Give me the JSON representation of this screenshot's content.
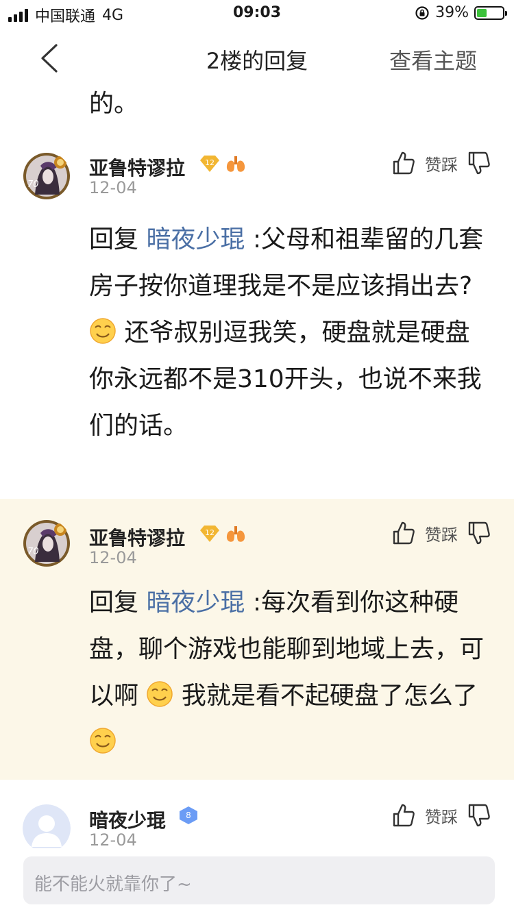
{
  "status_bar": {
    "carrier": "中国联通",
    "network": "4G",
    "time": "09:03",
    "battery": "39%",
    "battery_level": 0.39
  },
  "nav": {
    "title": "2楼的回复",
    "view_topic": "查看主题"
  },
  "partial_text": "的。",
  "replies": [
    {
      "username": "亚鲁特谬拉",
      "level_badge": "12",
      "avatar_level": "70",
      "date": "12-04",
      "vote_label": "赞踩",
      "reply_prefix": "回复",
      "mention": "暗夜少琨",
      "text_part1": ":父母和祖辈留的几套房子按你道理我是不是应该捐出去?",
      "text_part2": "还爷叔别逗我笑，硬盘就是硬盘你永远都不是310开头，也说不来我们的话。"
    },
    {
      "username": "亚鲁特谬拉",
      "level_badge": "12",
      "avatar_level": "70",
      "date": "12-04",
      "vote_label": "赞踩",
      "reply_prefix": "回复",
      "mention": "暗夜少琨",
      "text_part1": ":每次看到你这种硬盘，聊个游戏也能聊到地域上去，可以啊",
      "text_part2": "我就是看不起硬盘了怎么了"
    },
    {
      "username": "暗夜少琨",
      "level_badge": "8",
      "date": "12-04",
      "vote_label": "赞踩"
    }
  ],
  "input": {
    "placeholder": "能不能火就靠你了~"
  },
  "colors": {
    "mention": "#4a6fa5",
    "highlight_bg": "#fcf7e8",
    "badge_gold": "#f2b632",
    "badge_blue": "#6b9cf5"
  }
}
